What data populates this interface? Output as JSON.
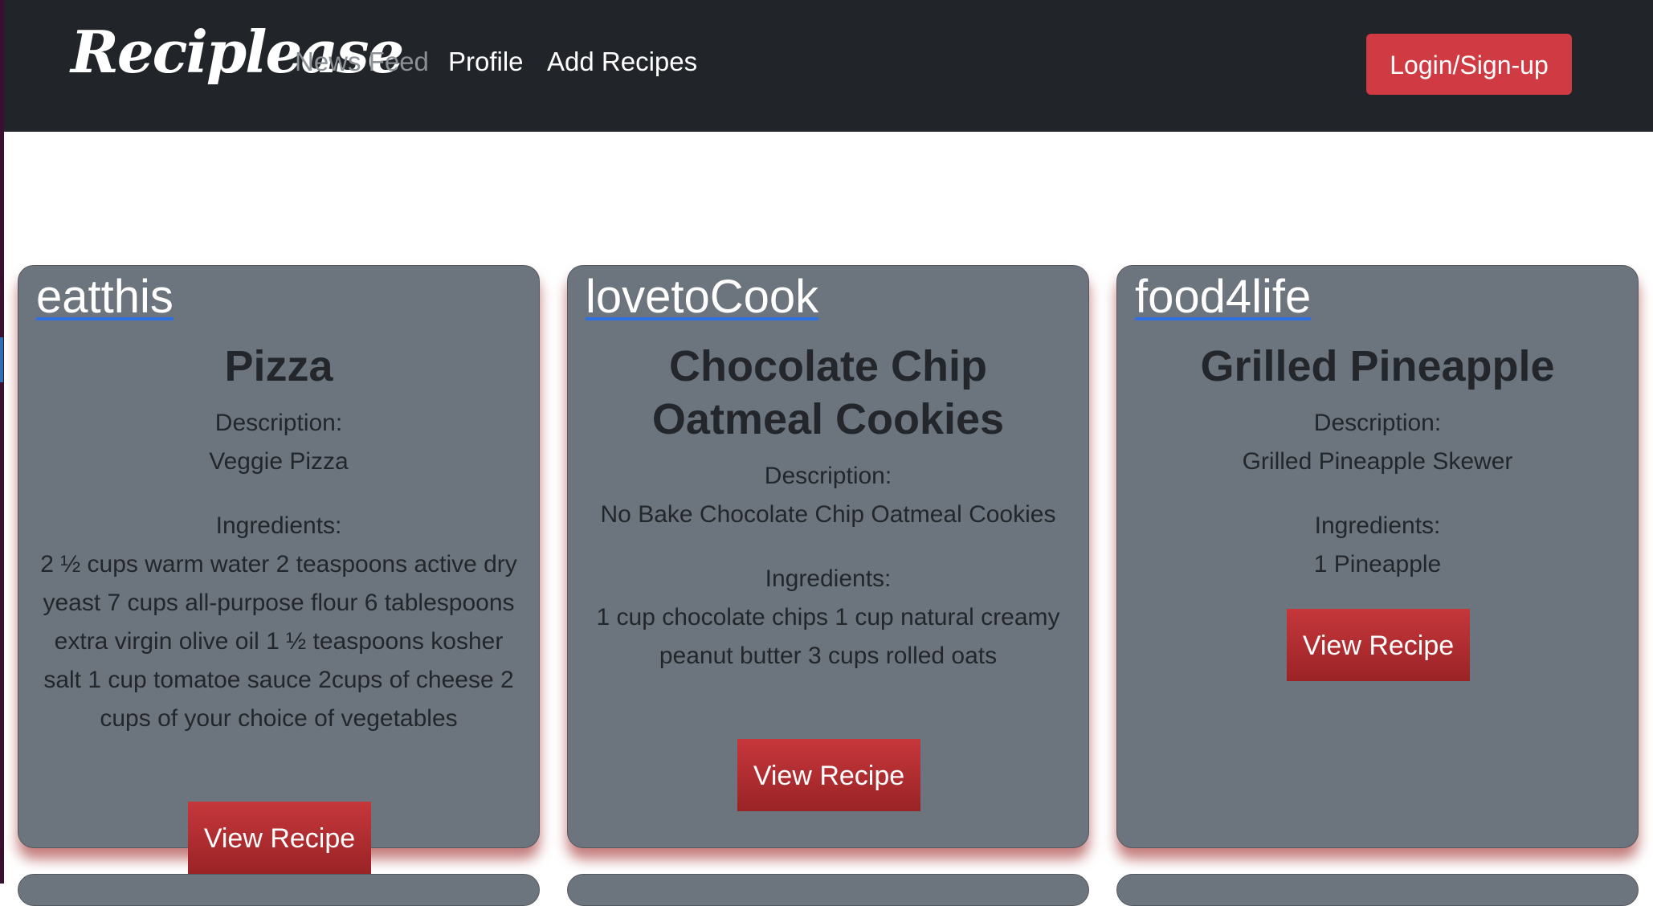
{
  "nav": {
    "brand": "Reciplease",
    "links": [
      "News Feed",
      "Profile",
      "Add Recipes"
    ],
    "login_label": "Login/Sign-up"
  },
  "labels": {
    "description": "Description:",
    "ingredients": "Ingredients:"
  },
  "cards": [
    {
      "user": "eatthis",
      "title": "Pizza",
      "description": "Veggie Pizza",
      "ingredients": "2 ½ cups warm water 2 teaspoons active dry yeast 7 cups all-purpose flour 6 tablespoons extra virgin olive oil 1 ½ teaspoons kosher salt 1 cup tomatoe sauce 2cups of cheese 2 cups of your choice of vegetables",
      "button": "View Recipe"
    },
    {
      "user": "lovetoCook",
      "title": "Chocolate Chip Oatmeal Cookies",
      "description": "No Bake Chocolate Chip Oatmeal Cookies",
      "ingredients": "1 cup chocolate chips 1 cup natural creamy peanut butter 3 cups rolled oats",
      "button": "View Recipe"
    },
    {
      "user": "food4life",
      "title": "Grilled Pineapple",
      "description": "Grilled Pineapple Skewer",
      "ingredients": "1 Pineapple",
      "button": "View Recipe"
    }
  ],
  "colors": {
    "navbar": "#212529",
    "card": "#6c757d",
    "accent": "#d03b43",
    "button": "#b52f33"
  }
}
